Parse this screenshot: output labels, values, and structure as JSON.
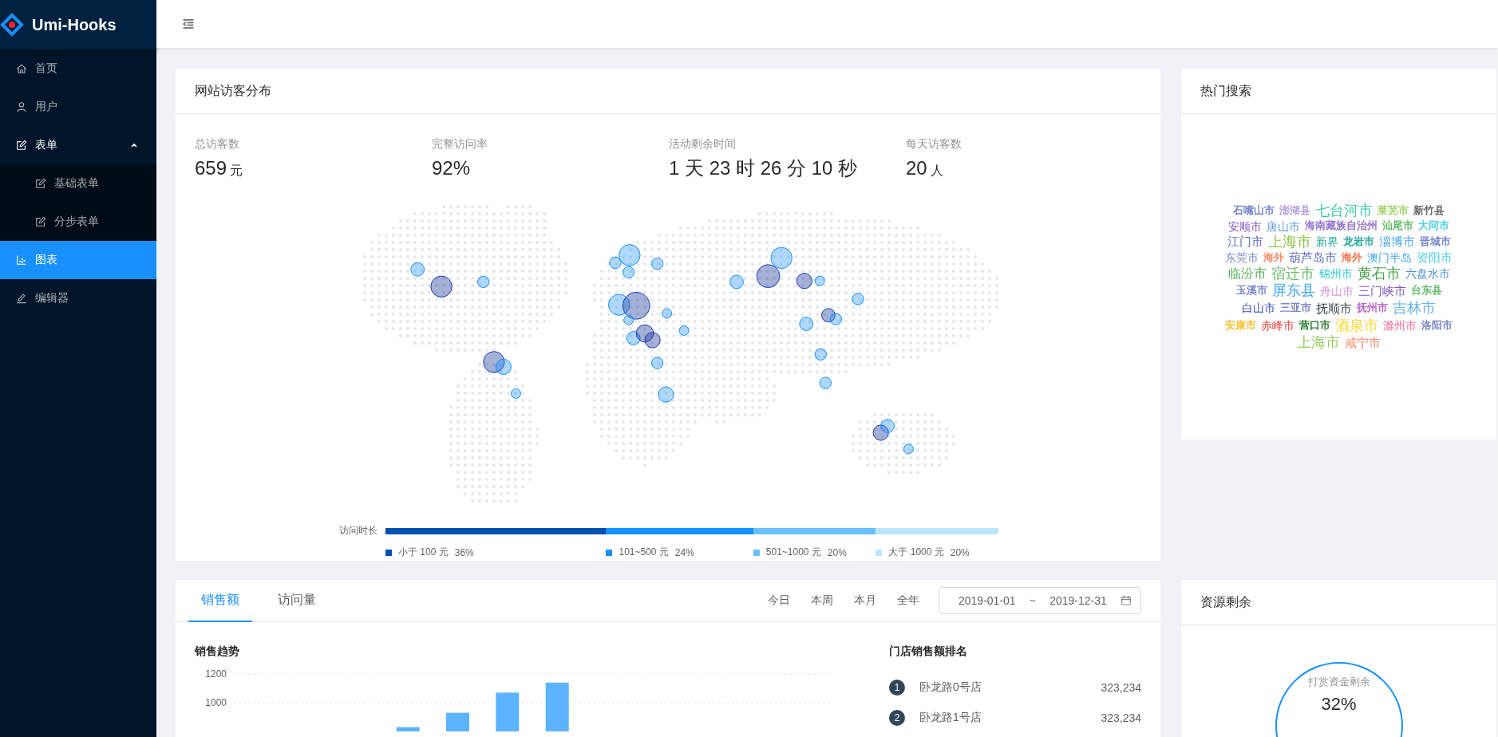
{
  "sidebar": {
    "logo": "Umi-Hooks",
    "items": [
      {
        "label": "首页",
        "selected": false
      },
      {
        "label": "用户",
        "selected": false
      },
      {
        "label": "表单",
        "selected": false,
        "expanded": true,
        "children": [
          {
            "label": "基础表单",
            "selected": false
          },
          {
            "label": "分步表单",
            "selected": false
          }
        ]
      },
      {
        "label": "图表",
        "selected": true
      },
      {
        "label": "编辑器",
        "selected": false
      }
    ]
  },
  "visitor_card": {
    "title": "网站访客分布",
    "stats": [
      {
        "label": "总访客数",
        "value": "659",
        "unit": "元"
      },
      {
        "label": "完整访问率",
        "value": "92%"
      },
      {
        "label": "活动剩余时间",
        "value": "1 天 23 时 26 分 10 秒"
      },
      {
        "label": "每天访客数",
        "value": "20",
        "unit": "人"
      }
    ],
    "legend": {
      "title": "访问时长",
      "items": [
        {
          "label": "小于 100 元",
          "percent": "36%",
          "color": "#0050b3"
        },
        {
          "label": "101~500 元",
          "percent": "24%",
          "color": "#1890ff"
        },
        {
          "label": "501~1000 元",
          "percent": "20%",
          "color": "#69c0ff"
        },
        {
          "label": "大于 1000 元",
          "percent": "20%",
          "color": "#bae7ff"
        }
      ]
    }
  },
  "hot_search": {
    "title": "热门搜索",
    "words": [
      {
        "text": "石嘴山市",
        "color": "#7986cb"
      },
      {
        "text": "澎湖县",
        "color": "#b39ddb"
      },
      {
        "text": "七台河市",
        "color": "#3cc9a8"
      },
      {
        "text": "莱芜市",
        "color": "#a0d468"
      },
      {
        "text": "新竹县",
        "color": "#666666"
      },
      {
        "text": "安顺市",
        "color": "#7e57c2"
      },
      {
        "text": "唐山市",
        "color": "#5c9bd6"
      },
      {
        "text": "海南藏族自治州",
        "color": "#9575cd"
      },
      {
        "text": "汕尾市",
        "color": "#66bb6a"
      },
      {
        "text": "大同市",
        "color": "#4dd0e1"
      },
      {
        "text": "江门市",
        "color": "#5c6bc0"
      },
      {
        "text": "上海市",
        "color": "#8bc34a"
      },
      {
        "text": "新界",
        "color": "#26a69a"
      },
      {
        "text": "龙岩市",
        "color": "#26a69a"
      },
      {
        "text": "淄博市",
        "color": "#42a5f5"
      },
      {
        "text": "晋城市",
        "color": "#7986cb"
      },
      {
        "text": "东莞市",
        "color": "#7986cb"
      },
      {
        "text": "海外",
        "color": "#ff8a65"
      },
      {
        "text": "葫芦岛市",
        "color": "#5c6bc0"
      },
      {
        "text": "海外",
        "color": "#ff7043"
      },
      {
        "text": "澳门半岛",
        "color": "#42a5f5"
      },
      {
        "text": "资阳市",
        "color": "#4dd0e1"
      },
      {
        "text": "临汾市",
        "color": "#4caf50"
      },
      {
        "text": "宿迁市",
        "color": "#66bb6a"
      },
      {
        "text": "锦州市",
        "color": "#26c6da"
      },
      {
        "text": "黄石市",
        "color": "#43a047"
      },
      {
        "text": "六盘水市",
        "color": "#3f8fd6"
      },
      {
        "text": "玉溪市",
        "color": "#7986cb"
      },
      {
        "text": "屏东县",
        "color": "#42a5f5"
      },
      {
        "text": "舟山市",
        "color": "#ce93d8"
      },
      {
        "text": "三门峡市",
        "color": "#7e57c2"
      },
      {
        "text": "台东县",
        "color": "#66bb6a"
      },
      {
        "text": "白山市",
        "color": "#3949ab"
      },
      {
        "text": "三亚市",
        "color": "#7986cb"
      },
      {
        "text": "抚顺市",
        "color": "#37474f"
      },
      {
        "text": "抚州市",
        "color": "#ba68c8"
      },
      {
        "text": "吉林市",
        "color": "#64b5f6"
      },
      {
        "text": "安康市",
        "color": "#fbc02d"
      },
      {
        "text": "赤峰市",
        "color": "#e53935"
      },
      {
        "text": "营口市",
        "color": "#2e7d32"
      },
      {
        "text": "酒泉市",
        "color": "#fdd835"
      },
      {
        "text": "滁州市",
        "color": "#f06292"
      },
      {
        "text": "洛阳市",
        "color": "#7986cb"
      },
      {
        "text": "上海市",
        "color": "#9ccc65"
      },
      {
        "text": "咸宁市",
        "color": "#ff8a65"
      }
    ]
  },
  "sales": {
    "tabs": [
      {
        "label": "销售额",
        "selected": true
      },
      {
        "label": "访问量",
        "selected": false
      }
    ],
    "periods": [
      "今日",
      "本周",
      "本月",
      "全年"
    ],
    "date_range": {
      "start": "2019-01-01",
      "separator": "~",
      "end": "2019-12-31"
    },
    "trend": {
      "title": "销售趋势",
      "chart_data": {
        "type": "bar",
        "values": [
          null,
          null,
          null,
          830,
          930,
          1070,
          1140,
          null,
          null,
          null,
          null,
          null
        ],
        "ylim": [
          800,
          1200
        ],
        "yticks": [
          1000,
          1200
        ]
      }
    },
    "ranking": {
      "title": "门店销售额排名",
      "rows": [
        {
          "rank": "1",
          "name": "卧龙路0号店",
          "amount": "323,234"
        },
        {
          "rank": "2",
          "name": "卧龙路1号店",
          "amount": "323,234"
        }
      ]
    }
  },
  "resource": {
    "title": "资源剩余",
    "gauge": {
      "label": "打赏资金剩余",
      "value": "32%"
    }
  }
}
